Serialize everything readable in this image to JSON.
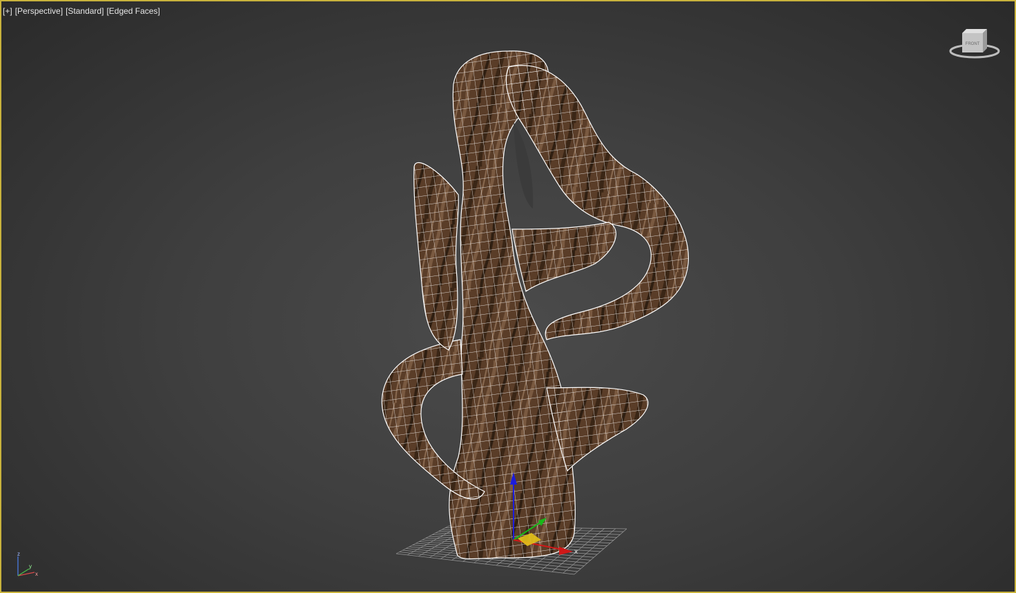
{
  "viewport": {
    "labels": {
      "menu": "[+]",
      "view": "[Perspective]",
      "shading": "[Standard]",
      "edges": "[Edged Faces]"
    }
  },
  "viewcube": {
    "face_label": "FRONT",
    "icon": "viewcube-icon"
  },
  "gizmo": {
    "x_label": "x",
    "y_label": "y",
    "z_label": "z",
    "colors": {
      "x": "#d01818",
      "y": "#18b818",
      "z": "#1c1cdc",
      "plane": "#e6c21a"
    }
  },
  "axis_tripod": {
    "x_label": "x",
    "y_label": "y",
    "z_label": "z"
  },
  "object": {
    "material": "wood-texture",
    "wire_color": "#ffffff",
    "colors": {
      "dark": "#3b2718",
      "mid": "#6a4b33",
      "light": "#8e6b4f"
    }
  },
  "grid": {
    "color": "#9a9a9a"
  }
}
